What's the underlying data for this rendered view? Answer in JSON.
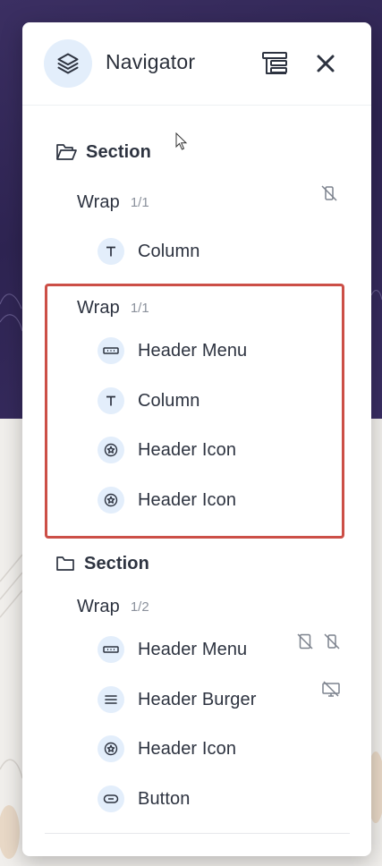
{
  "navigator": {
    "title": "Navigator",
    "header_icons": [
      "layers-icon",
      "structure-icon",
      "close-icon"
    ]
  },
  "tree": {
    "section1": {
      "label": "Section",
      "icon": "folder-open-icon"
    },
    "wrap1": {
      "label": "Wrap",
      "count": "1/1",
      "status_icon": "mobile-hidden-icon"
    },
    "wrap1_column": {
      "label": "Column",
      "icon": "text-icon"
    },
    "wrap2": {
      "label": "Wrap",
      "count": "1/1",
      "highlighted": true,
      "highlight_color": "#cc4f47"
    },
    "wrap2_items": [
      {
        "label": "Header Menu",
        "icon": "menu-bar-icon"
      },
      {
        "label": "Column",
        "icon": "text-icon"
      },
      {
        "label": "Header Icon",
        "icon": "star-badge-icon"
      },
      {
        "label": "Header Icon",
        "icon": "star-badge-icon"
      }
    ],
    "section2": {
      "label": "Section",
      "icon": "folder-icon"
    },
    "wrap3": {
      "label": "Wrap",
      "count": "1/2"
    },
    "wrap3_items": [
      {
        "label": "Header Menu",
        "icon": "menu-bar-icon",
        "status_icons": [
          "tablet-hidden-icon",
          "mobile-hidden-icon"
        ]
      },
      {
        "label": "Header Burger",
        "icon": "hamburger-icon",
        "status_icons": [
          "desktop-hidden-icon"
        ]
      },
      {
        "label": "Header Icon",
        "icon": "star-badge-icon"
      },
      {
        "label": "Button",
        "icon": "button-icon"
      }
    ]
  },
  "colors": {
    "accent_bg": "#e3eefb",
    "icon_stroke": "#2d3340",
    "highlight": "#cc4f47",
    "panel_bg": "#ffffff"
  }
}
